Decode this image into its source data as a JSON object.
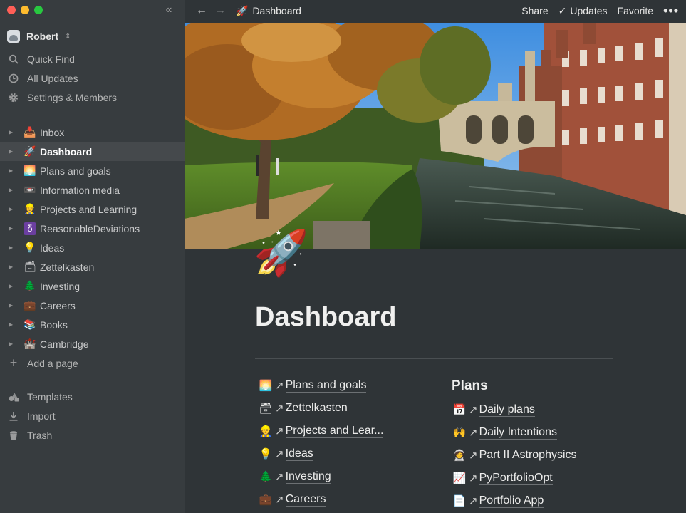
{
  "window": {
    "traffic_colors": [
      "#ff5f57",
      "#febc2e",
      "#28c840"
    ]
  },
  "sidebar": {
    "collapse_icon": "double-chevron-left-icon",
    "workspace": {
      "name": "Robert"
    },
    "nav": [
      {
        "label": "Quick Find",
        "icon": "search-icon"
      },
      {
        "label": "All Updates",
        "icon": "clock-icon"
      },
      {
        "label": "Settings & Members",
        "icon": "gear-icon"
      }
    ],
    "pages": [
      {
        "label": "Inbox",
        "emoji": "📥"
      },
      {
        "label": "Dashboard",
        "emoji": "🚀",
        "active": true
      },
      {
        "label": "Plans and goals",
        "emoji": "🌅"
      },
      {
        "label": "Information media",
        "emoji": "📼"
      },
      {
        "label": "Projects and Learning",
        "emoji": "👷"
      },
      {
        "label": "ReasonableDeviations",
        "emoji": "δ"
      },
      {
        "label": "Ideas",
        "emoji": "💡"
      },
      {
        "label": "Zettelkasten",
        "emoji": "🗃"
      },
      {
        "label": "Investing",
        "emoji": "🌲"
      },
      {
        "label": "Careers",
        "emoji": "💼"
      },
      {
        "label": "Books",
        "emoji": "📚"
      },
      {
        "label": "Cambridge",
        "emoji": "🏰"
      }
    ],
    "add_page": "Add a page",
    "bottom": [
      {
        "label": "Templates",
        "icon": "shapes-icon"
      },
      {
        "label": "Import",
        "icon": "download-icon"
      },
      {
        "label": "Trash",
        "icon": "trash-icon"
      }
    ]
  },
  "topbar": {
    "breadcrumb": {
      "emoji": "🚀",
      "label": "Dashboard"
    },
    "share": "Share",
    "updates": "Updates",
    "favorite": "Favorite",
    "more": "•••"
  },
  "page": {
    "icon": "🚀",
    "title": "Dashboard",
    "left_links": [
      {
        "emoji": "🌅",
        "label": "Plans and goals"
      },
      {
        "emoji": "🗃",
        "label": "Zettelkasten"
      },
      {
        "emoji": "👷",
        "label": "Projects and Lear..."
      },
      {
        "emoji": "💡",
        "label": "Ideas"
      },
      {
        "emoji": "🌲",
        "label": "Investing"
      },
      {
        "emoji": "💼",
        "label": "Careers"
      }
    ],
    "right_heading": "Plans",
    "right_links": [
      {
        "emoji": "📅",
        "label": "Daily plans"
      },
      {
        "emoji": "🙌",
        "label": "Daily Intentions"
      },
      {
        "emoji": "🧑‍🚀",
        "label": "Part II Astrophysics"
      },
      {
        "emoji": "📈",
        "label": "PyPortfolioOpt"
      },
      {
        "emoji": "📄",
        "label": "Portfolio App"
      }
    ],
    "link_arrow": "↗"
  }
}
